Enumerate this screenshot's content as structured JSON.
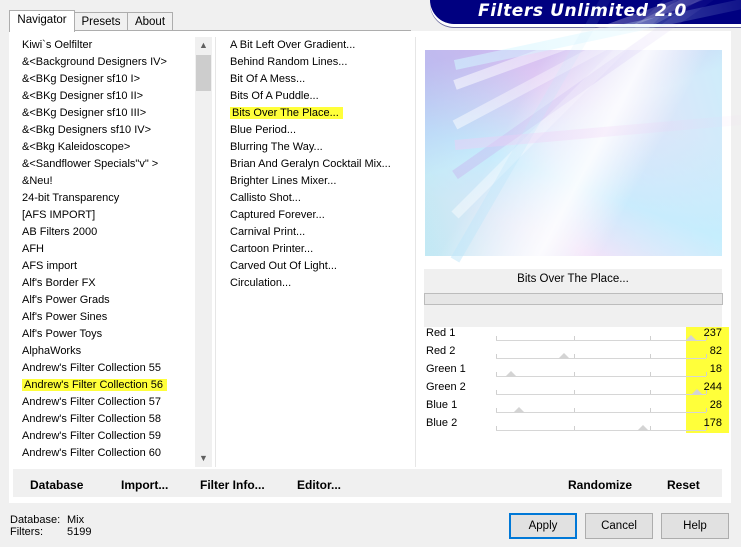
{
  "window": {
    "title": "Filters Unlimited 2.0"
  },
  "tabs": [
    {
      "label": "Navigator",
      "active": true
    },
    {
      "label": "Presets",
      "active": false
    },
    {
      "label": "About",
      "active": false
    }
  ],
  "categories": {
    "items": [
      "Kiwi`s Oelfilter",
      "&<Background Designers IV>",
      "&<BKg Designer sf10 I>",
      "&<BKg Designer sf10 II>",
      "&<BKg Designer sf10 III>",
      "&<Bkg Designers sf10 IV>",
      "&<Bkg Kaleidoscope>",
      "&<Sandflower Specials\"v\" >",
      "&Neu!",
      "24-bit Transparency",
      "[AFS IMPORT]",
      "AB Filters 2000",
      "AFH",
      "AFS import",
      "Alf's Border FX",
      "Alf's Power Grads",
      "Alf's Power Sines",
      "Alf's Power Toys",
      "AlphaWorks",
      "Andrew's Filter Collection 55",
      "Andrew's Filter Collection 56",
      "Andrew's Filter Collection 57",
      "Andrew's Filter Collection 58",
      "Andrew's Filter Collection 59",
      "Andrew's Filter Collection 60"
    ],
    "selected_index": 20
  },
  "filters": {
    "items": [
      "A Bit Left Over Gradient...",
      "Behind Random Lines...",
      "Bit Of A Mess...",
      "Bits Of A Puddle...",
      "Bits Over The Place...",
      "Blue Period...",
      "Blurring The Way...",
      "Brian And Geralyn Cocktail Mix...",
      "Brighter Lines Mixer...",
      "Callisto Shot...",
      "Captured Forever...",
      "Carnival Print...",
      "Cartoon Printer...",
      "Carved Out Of Light...",
      "Circulation..."
    ],
    "selected_index": 4
  },
  "preview": {
    "filter_name": "Bits Over The Place..."
  },
  "parameters": [
    {
      "label": "Red 1",
      "value": 237
    },
    {
      "label": "Red 2",
      "value": 82
    },
    {
      "label": "Green 1",
      "value": 18
    },
    {
      "label": "Green 2",
      "value": 244
    },
    {
      "label": "Blue 1",
      "value": 28
    },
    {
      "label": "Blue 2",
      "value": 178
    }
  ],
  "toolbar": {
    "database_label": "Database",
    "import_label": "Import...",
    "filter_info_label": "Filter Info...",
    "editor_label": "Editor...",
    "randomize_label": "Randomize",
    "reset_label": "Reset"
  },
  "status": {
    "database_label": "Database:",
    "database_value": "Mix",
    "filters_label": "Filters:",
    "filters_value": "5199"
  },
  "buttons": {
    "apply": "Apply",
    "cancel": "Cancel",
    "help": "Help"
  },
  "colors": {
    "highlight": "#ffff3a",
    "banner": "#000080"
  }
}
